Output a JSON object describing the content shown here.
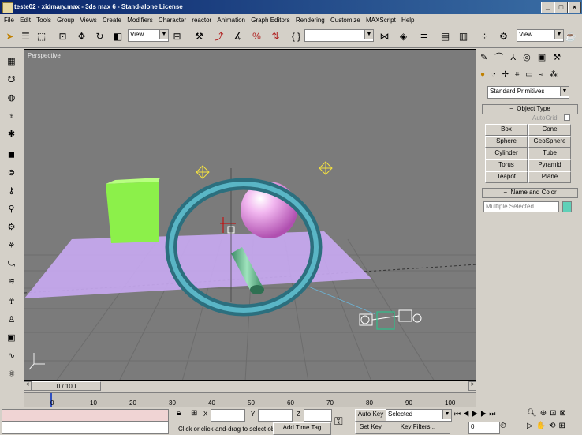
{
  "window": {
    "title": "teste02 - xidmary.max - 3ds max 6 - Stand-alone License"
  },
  "menu": [
    "File",
    "Edit",
    "Tools",
    "Group",
    "Views",
    "Create",
    "Modifiers",
    "Character",
    "reactor",
    "Animation",
    "Graph Editors",
    "Rendering",
    "Customize",
    "MAXScript",
    "Help"
  ],
  "toolbar": {
    "ref_coord": "View",
    "view_right": "View",
    "selection_set": ""
  },
  "viewport": {
    "label": "Perspective"
  },
  "command_panel": {
    "category": "Standard Primitives",
    "object_type_title": "Object Type",
    "autogrid": "AutoGrid",
    "buttons": [
      "Box",
      "Cone",
      "Sphere",
      "GeoSphere",
      "Cylinder",
      "Tube",
      "Torus",
      "Pyramid",
      "Teapot",
      "Plane"
    ],
    "name_color_title": "Name and Color",
    "name_value": "Multiple Selected",
    "name_color": "#5fd0b8"
  },
  "timeline": {
    "frame": "0 / 100",
    "ticks": [
      "0",
      "10",
      "20",
      "30",
      "40",
      "50",
      "60",
      "70",
      "80",
      "90",
      "100"
    ]
  },
  "status": {
    "x_label": "X",
    "y_label": "Y",
    "z_label": "Z",
    "prompt": "Click or click-and-drag to select ob",
    "add_time_tag": "Add Time Tag",
    "auto_key": "Auto Key",
    "set_key": "Set Key",
    "key_filter_select": "Selected",
    "key_filters": "Key Filters...",
    "frame_field": "0"
  }
}
